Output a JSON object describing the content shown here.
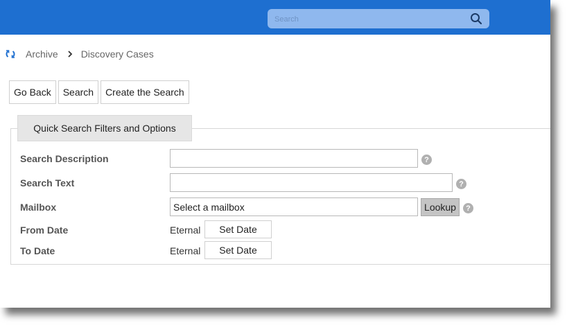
{
  "header": {
    "search": {
      "placeholder": "Search",
      "value": "",
      "icon": "search-icon"
    },
    "bar_color": "#1e6fd0"
  },
  "breadcrumb": {
    "icon": "refresh-icon",
    "items": [
      "Archive",
      "Discovery Cases"
    ],
    "separator_icon": "chevron-right-icon"
  },
  "toolbar": {
    "go_back": "Go Back",
    "search": "Search",
    "create_search": "Create the Search"
  },
  "panel": {
    "title": "Quick Search Filters and Options",
    "search_description": {
      "label": "Search Description",
      "value": ""
    },
    "search_text": {
      "label": "Search Text",
      "value": ""
    },
    "mailbox": {
      "label": "Mailbox",
      "value": "Select a mailbox",
      "lookup_label": "Lookup"
    },
    "from_date": {
      "label": "From Date",
      "value": "Eternal",
      "button": "Set Date"
    },
    "to_date": {
      "label": "To Date",
      "value": "Eternal",
      "button": "Set Date"
    },
    "help_glyph": "?"
  }
}
